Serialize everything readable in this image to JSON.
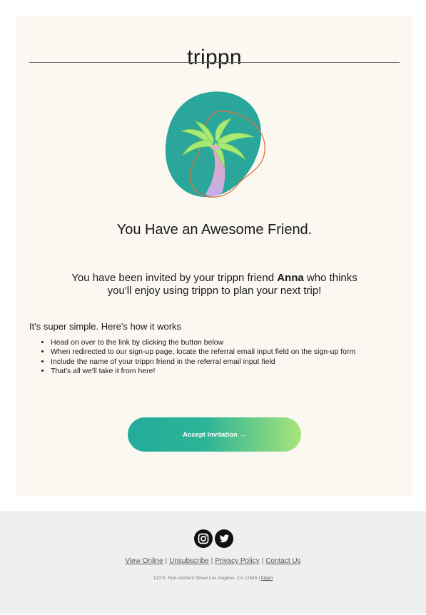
{
  "header": {
    "brand": "trippn"
  },
  "hero": {
    "image": "palm-tree-illustration"
  },
  "main": {
    "headline": "You Have an Awesome Friend.",
    "invite_before": "You have been invited by your trippn friend ",
    "inviter_name": "Anna",
    "invite_after": " who thinks",
    "invite_line2": "you'll enjoy using trippn to plan your next trip!",
    "intro": "It's super simple. Here's how it works",
    "steps": [
      "Head on over to the link by clicking the button below",
      "When redirected to our sign-up page, locate the referral email input field on the sign-up form",
      "Include the name of your trippn friend in the referral email input field",
      "That's all we'll take it from here!"
    ],
    "cta_label": "Accept Invitation →"
  },
  "footer": {
    "social_icons": [
      "instagram-icon",
      "twitter-icon"
    ],
    "links": [
      "View Online",
      "Unsubscribe",
      "Privacy Policy",
      "Contact Us"
    ],
    "separator": "|",
    "address": "123 E. Non-existent Street Los Angeles, CA 12345",
    "address_separator": "|",
    "brand_link": "trippn"
  },
  "colors": {
    "card_bg": "#faf8f1",
    "footer_bg": "#efefef",
    "cta_start": "#22ab9b",
    "cta_end": "#a6e57a",
    "blob": "#2aa79a"
  }
}
